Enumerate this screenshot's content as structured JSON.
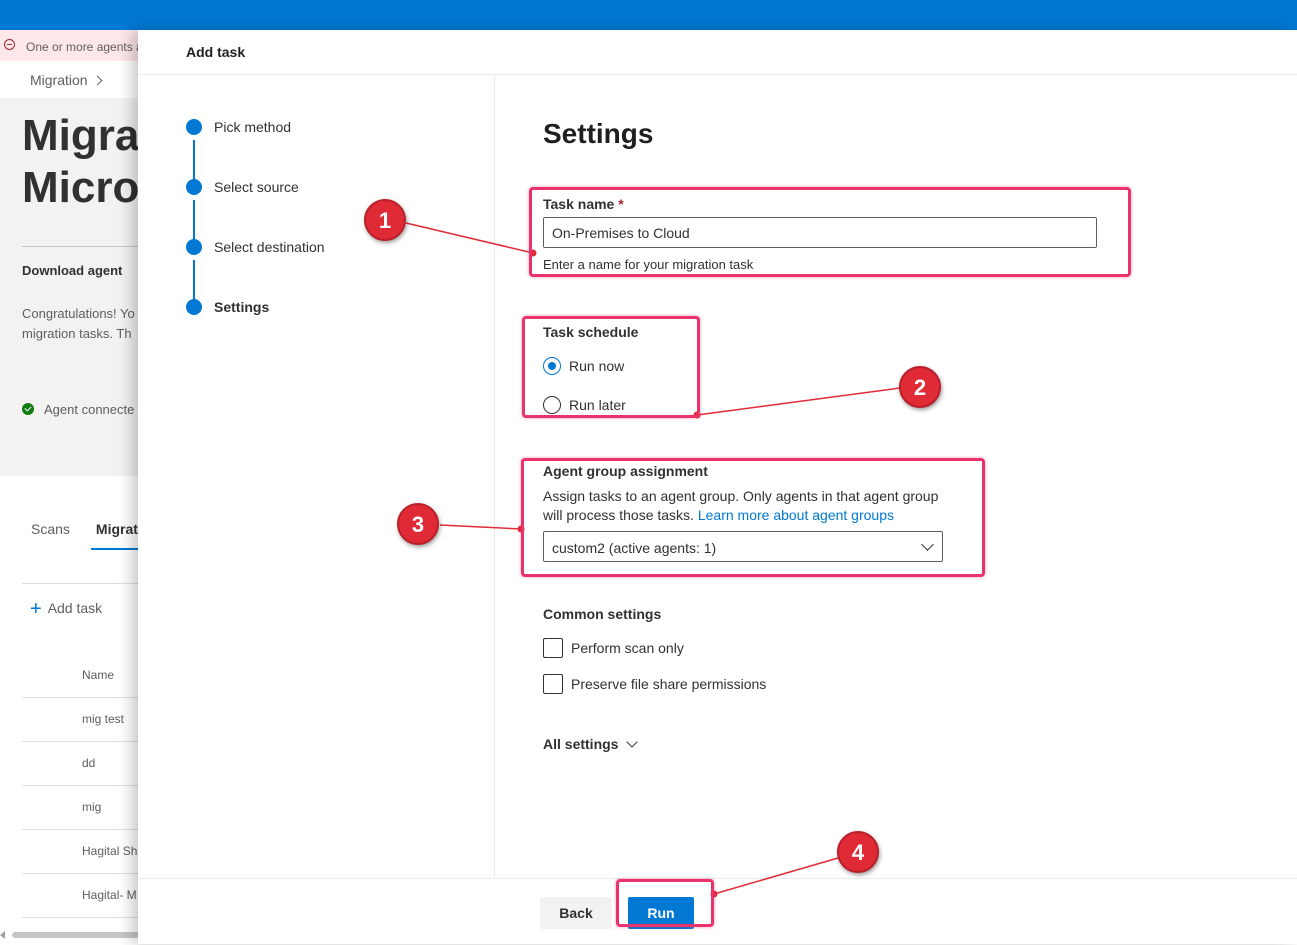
{
  "background_page": {
    "error_banner": "One or more agents a",
    "breadcrumb": "Migration",
    "title_line1": "Migra",
    "title_line2": "Micro",
    "download_agent": "Download agent",
    "congrats_line1": "Congratulations! Yo",
    "congrats_line2": "migration tasks. Th",
    "agent_status": "Agent connecte",
    "tabs": {
      "scans": "Scans",
      "migration": "Migrati"
    },
    "add_task": "Add task",
    "table": {
      "header": "Name",
      "rows": [
        "mig test",
        "dd",
        "mig",
        "Hagital Sha",
        "Hagital- M"
      ]
    }
  },
  "panel": {
    "title": "Add task",
    "steps": [
      {
        "label": "Pick method"
      },
      {
        "label": "Select source"
      },
      {
        "label": "Select destination"
      },
      {
        "label": "Settings"
      }
    ],
    "heading": "Settings",
    "task_name": {
      "label": "Task name",
      "required_mark": "*",
      "value": "On-Premises to Cloud",
      "helper": "Enter a name for your migration task"
    },
    "task_schedule": {
      "label": "Task schedule",
      "options": [
        {
          "label": "Run now",
          "selected": true
        },
        {
          "label": "Run later",
          "selected": false
        }
      ]
    },
    "agent_group": {
      "label": "Agent group assignment",
      "description_line1": "Assign tasks to an agent group. Only agents in that agent group",
      "description_line2": "will process those tasks.",
      "link": "Learn more about agent groups",
      "selected": "custom2 (active agents: 1)"
    },
    "common_settings": {
      "label": "Common settings",
      "options": [
        {
          "label": "Perform scan only",
          "checked": false
        },
        {
          "label": "Preserve file share permissions",
          "checked": false
        }
      ]
    },
    "all_settings": "All settings",
    "footer": {
      "back": "Back",
      "run": "Run"
    }
  },
  "annotations": [
    "1",
    "2",
    "3",
    "4"
  ],
  "colors": {
    "accent": "#0078d4",
    "highlight": "#e8336b",
    "badge": "#e02b36",
    "topbar": "#0078d4"
  }
}
